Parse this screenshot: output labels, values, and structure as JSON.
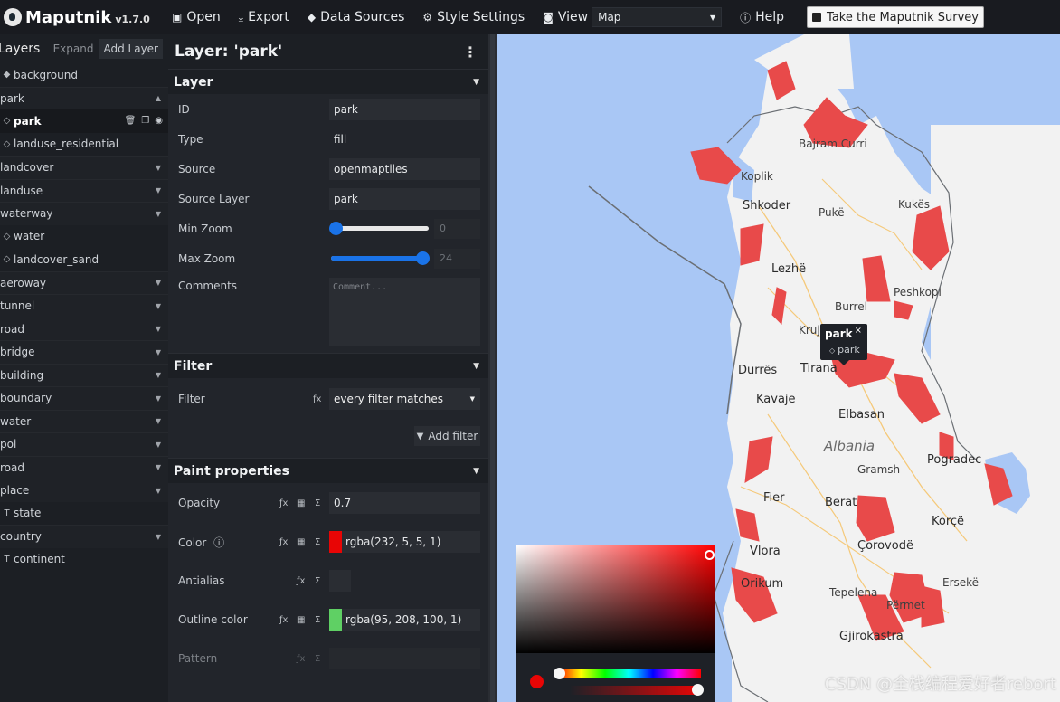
{
  "app": {
    "name": "Maputnik",
    "version": "v1.7.0"
  },
  "toolbar": {
    "open": "Open",
    "export": "Export",
    "data_sources": "Data Sources",
    "style_settings": "Style Settings",
    "view": "View",
    "view_value": "Map",
    "help": "Help",
    "survey": "Take the Maputnik Survey"
  },
  "layer_list": {
    "title": "Layers",
    "expand": "Expand",
    "add": "Add Layer",
    "items": [
      {
        "label": "background",
        "kind": "layer",
        "icon": "fill"
      },
      {
        "label": "park",
        "kind": "group",
        "open": true
      },
      {
        "label": "park",
        "kind": "layer",
        "selected": true
      },
      {
        "label": "landuse_residential",
        "kind": "layer"
      },
      {
        "label": "landcover",
        "kind": "group"
      },
      {
        "label": "landuse",
        "kind": "group"
      },
      {
        "label": "waterway",
        "kind": "group"
      },
      {
        "label": "water",
        "kind": "layer"
      },
      {
        "label": "landcover_sand",
        "kind": "layer"
      },
      {
        "label": "aeroway",
        "kind": "group"
      },
      {
        "label": "tunnel",
        "kind": "group"
      },
      {
        "label": "road",
        "kind": "group"
      },
      {
        "label": "bridge",
        "kind": "group"
      },
      {
        "label": "building",
        "kind": "group"
      },
      {
        "label": "boundary",
        "kind": "group"
      },
      {
        "label": "water",
        "kind": "group"
      },
      {
        "label": "poi",
        "kind": "group"
      },
      {
        "label": "road",
        "kind": "group"
      },
      {
        "label": "place",
        "kind": "group"
      },
      {
        "label": "state",
        "kind": "symbol"
      },
      {
        "label": "country",
        "kind": "group"
      },
      {
        "label": "continent",
        "kind": "symbol"
      }
    ]
  },
  "editor": {
    "title": "Layer: 'park'",
    "layer_section": "Layer",
    "id_label": "ID",
    "id_value": "park",
    "type_label": "Type",
    "type_value": "fill",
    "source_label": "Source",
    "source_value": "openmaptiles",
    "source_layer_label": "Source Layer",
    "source_layer_value": "park",
    "min_zoom_label": "Min Zoom",
    "min_zoom_value": "0",
    "max_zoom_label": "Max Zoom",
    "max_zoom_value": "24",
    "comments_label": "Comments",
    "comments_placeholder": "Comment...",
    "filter_section": "Filter",
    "filter_label": "Filter",
    "filter_value": "every filter matches",
    "add_filter": "Add filter",
    "paint_section": "Paint properties",
    "opacity_label": "Opacity",
    "opacity_value": "0.7",
    "color_label": "Color",
    "color_value": "rgba(232, 5, 5, 1)",
    "antialias_label": "Antialias",
    "outline_label": "Outline color",
    "outline_value": "rgba(95, 208, 100, 1)",
    "pattern_label": "Pattern"
  },
  "colors": {
    "fill": "#e80505",
    "outline": "#5fd064",
    "accent": "#1a73e8",
    "water": "#a9c7f5",
    "land": "#f2f2f2"
  },
  "map": {
    "places": [
      {
        "name": "Bajram Curri",
        "cls": ""
      },
      {
        "name": "Koplik",
        "cls": ""
      },
      {
        "name": "Shkoder",
        "cls": "major"
      },
      {
        "name": "Pukë",
        "cls": ""
      },
      {
        "name": "Kukës",
        "cls": ""
      },
      {
        "name": "Lezhë",
        "cls": "major"
      },
      {
        "name": "Peshkopi",
        "cls": ""
      },
      {
        "name": "Burrel",
        "cls": ""
      },
      {
        "name": "Kruj",
        "cls": ""
      },
      {
        "name": "Durrës",
        "cls": "major"
      },
      {
        "name": "Tirana",
        "cls": "major"
      },
      {
        "name": "Kavaje",
        "cls": "major"
      },
      {
        "name": "Elbasan",
        "cls": "major"
      },
      {
        "name": "Albania",
        "cls": "country"
      },
      {
        "name": "Gramsh",
        "cls": ""
      },
      {
        "name": "Pogradec",
        "cls": "major"
      },
      {
        "name": "Fier",
        "cls": "major"
      },
      {
        "name": "Berat",
        "cls": "major"
      },
      {
        "name": "Korçë",
        "cls": "major"
      },
      {
        "name": "Vlora",
        "cls": "major"
      },
      {
        "name": "Çorovodë",
        "cls": "major"
      },
      {
        "name": "Orikum",
        "cls": "major"
      },
      {
        "name": "Tepelena",
        "cls": ""
      },
      {
        "name": "Përmet",
        "cls": ""
      },
      {
        "name": "Ersekë",
        "cls": ""
      },
      {
        "name": "Gjirokastra",
        "cls": "major"
      }
    ],
    "popup_title": "park",
    "popup_close": "×",
    "popup_layer": "park"
  },
  "watermark": "CSDN @全栈编程爱好者rebort"
}
